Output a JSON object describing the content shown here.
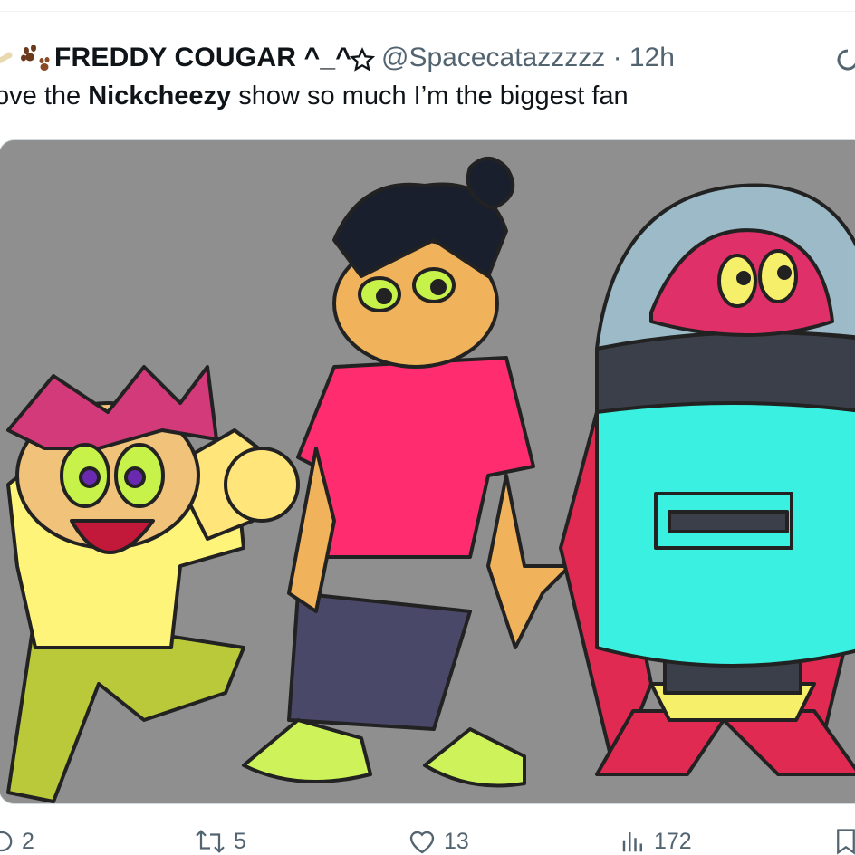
{
  "tweet": {
    "display_name": "FREDDY COUGAR ^_^",
    "handle": "@Spacecatazzzzz",
    "separator": "·",
    "time": "12h",
    "text_before": "ove the",
    "text_bold": "Nickcheezy",
    "text_after": "show so much I’m the biggest fan",
    "icons": [
      "bone-icon",
      "paw-icon",
      "star-icon",
      "more-icon"
    ]
  },
  "media": {
    "type": "cartoon-illustration",
    "background": "#8f8f8f"
  },
  "actions": {
    "replies": "2",
    "reposts": "5",
    "likes": "13",
    "views": "172"
  },
  "colors": {
    "text": "#0f1419",
    "muted": "#536471",
    "border": "#cfd9de"
  }
}
